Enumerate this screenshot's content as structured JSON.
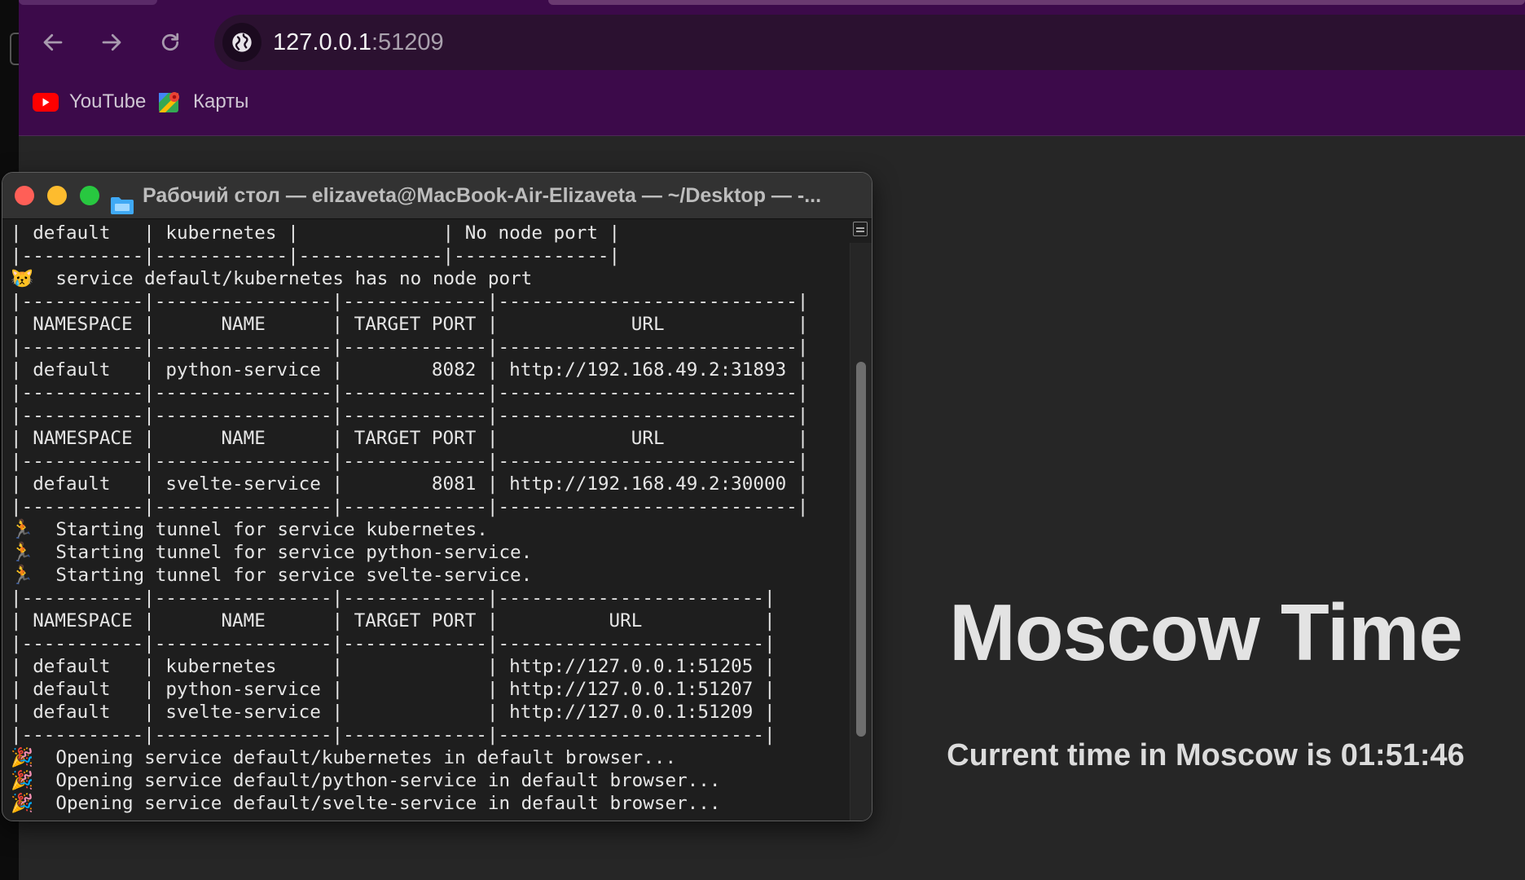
{
  "browser": {
    "address_host": "127.0.0.1",
    "address_port": ":51209",
    "bookmarks": [
      {
        "label": "YouTube",
        "icon": "youtube-icon"
      },
      {
        "label": "Карты",
        "icon": "maps-icon"
      }
    ],
    "colors": {
      "chrome": "#3c0a4a",
      "page_background": "#262626"
    }
  },
  "page": {
    "title": "Moscow Time",
    "subtitle": "Current time in Moscow is 01:51:46"
  },
  "terminal": {
    "title": "Рабочий стол — elizaveta@MacBook-Air-Elizaveta — ~/Desktop — -...",
    "lines": [
      "| default   | kubernetes |             | No node port |",
      "|-----------|------------|-------------|--------------|",
      "😿  service default/kubernetes has no node port",
      "|-----------|----------------|-------------|---------------------------|",
      "| NAMESPACE |      NAME      | TARGET PORT |            URL            |",
      "|-----------|----------------|-------------|---------------------------|",
      "| default   | python-service |        8082 | http://192.168.49.2:31893 |",
      "|-----------|----------------|-------------|---------------------------|",
      "|-----------|----------------|-------------|---------------------------|",
      "| NAMESPACE |      NAME      | TARGET PORT |            URL            |",
      "|-----------|----------------|-------------|---------------------------|",
      "| default   | svelte-service |        8081 | http://192.168.49.2:30000 |",
      "|-----------|----------------|-------------|---------------------------|",
      "🏃  Starting tunnel for service kubernetes.",
      "🏃  Starting tunnel for service python-service.",
      "🏃  Starting tunnel for service svelte-service.",
      "|-----------|----------------|-------------|------------------------|",
      "| NAMESPACE |      NAME      | TARGET PORT |          URL           |",
      "|-----------|----------------|-------------|------------------------|",
      "| default   | kubernetes     |             | http://127.0.0.1:51205 |",
      "| default   | python-service |             | http://127.0.0.1:51207 |",
      "| default   | svelte-service |             | http://127.0.0.1:51209 |",
      "|-----------|----------------|-------------|------------------------|",
      "🎉  Opening service default/kubernetes in default browser...",
      "🎉  Opening service default/python-service in default browser...",
      "🎉  Opening service default/svelte-service in default browser..."
    ]
  }
}
